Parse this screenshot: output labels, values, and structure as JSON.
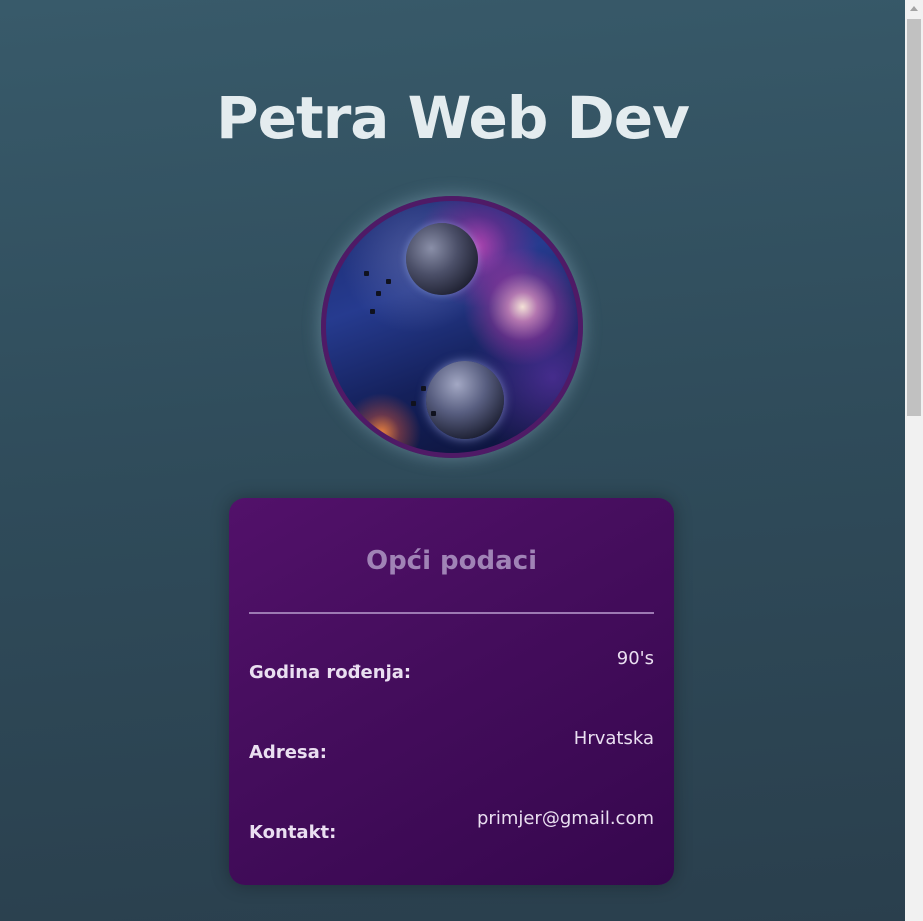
{
  "header": {
    "title": "Petra Web Dev"
  },
  "profile": {
    "avatar_icon": "space-nebula-image"
  },
  "info_card": {
    "title": "Opći podaci",
    "rows": [
      {
        "label": "Godina rođenja:",
        "value": "90's"
      },
      {
        "label": "Adresa:",
        "value": "Hrvatska"
      },
      {
        "label": "Kontakt:",
        "value": "primjer@gmail.com"
      }
    ]
  },
  "colors": {
    "background": "#2f4b5a",
    "title_text": "#e4ecef",
    "card_background": "#440d5c",
    "card_title": "#a083b6",
    "avatar_border": "#4f1a66"
  }
}
